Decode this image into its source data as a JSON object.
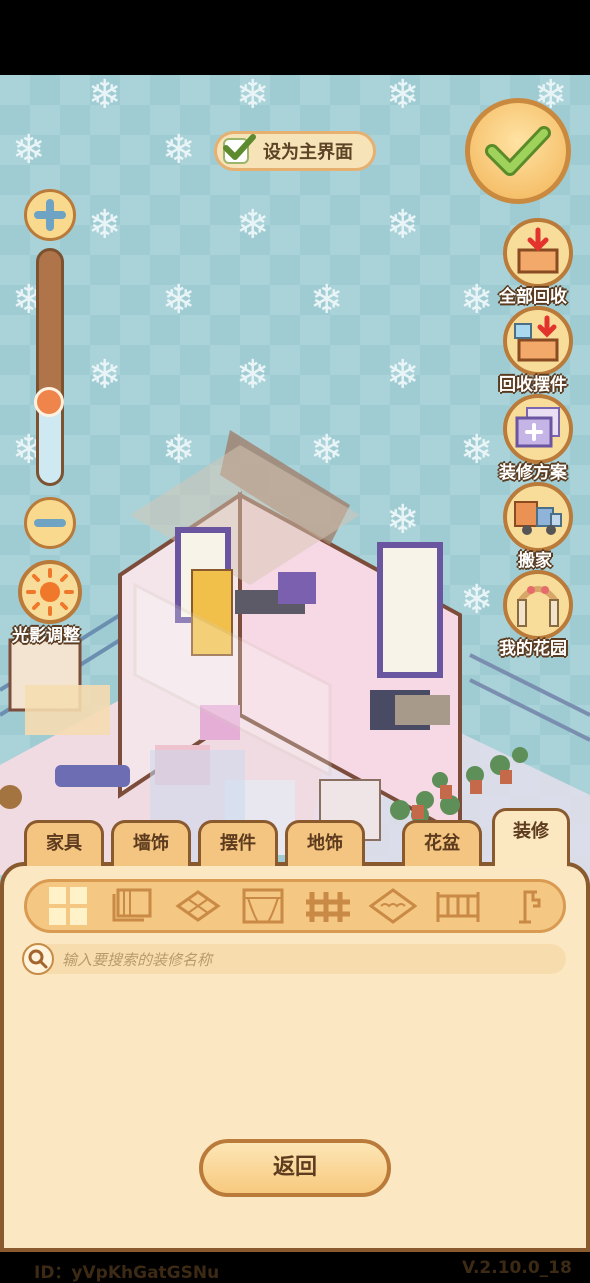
{
  "scene": {
    "set_home_label": "设为主界面",
    "light_label": "光影调整"
  },
  "side_buttons": [
    {
      "name": "recycle-all",
      "label": "全部回收",
      "icon": "recycle-box-icon"
    },
    {
      "name": "recycle-ornaments",
      "label": "回收摆件",
      "icon": "recycle-ornament-icon"
    },
    {
      "name": "decor-plans",
      "label": "装修方案",
      "icon": "plans-icon"
    },
    {
      "name": "move-house",
      "label": "搬家",
      "icon": "truck-icon"
    },
    {
      "name": "my-garden",
      "label": "我的花园",
      "icon": "garden-arch-icon"
    }
  ],
  "tabs": [
    "家具",
    "墙饰",
    "摆件",
    "地饰",
    "花盆",
    "装修"
  ],
  "active_tab": "装修",
  "subcategories": [
    "all-grid-icon",
    "wallpaper-icon",
    "floor-tile-icon",
    "window-icon",
    "fence-icon",
    "roof-tile-icon",
    "railing-icon",
    "lamp-icon"
  ],
  "search": {
    "placeholder": "输入要搜索的装修名称"
  },
  "back_label": "返回",
  "footer": {
    "id": "ID：yVpKhGatGSNu",
    "version": "V.2.10.0_18"
  },
  "colors": {
    "panel": "#fbe7c1",
    "tab": "#f4c580",
    "border": "#8a5a2f",
    "sky": "#a9d2d9"
  }
}
